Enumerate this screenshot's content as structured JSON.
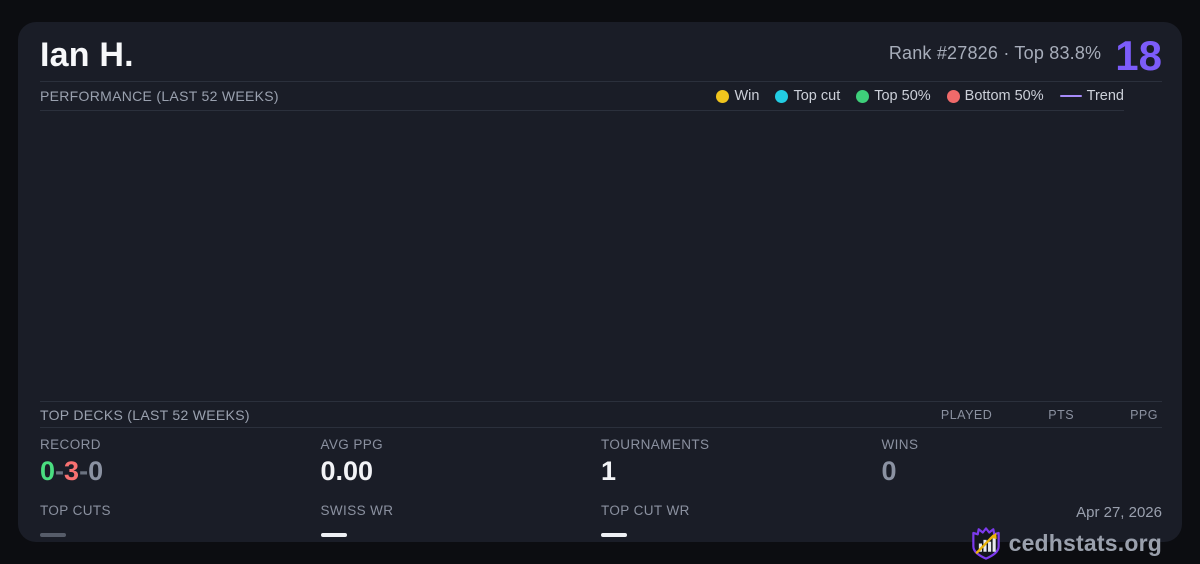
{
  "header": {
    "name": "Ian H.",
    "rank": "Rank #27826",
    "separator": "·",
    "top_percent": "Top 83.8%",
    "score": "18"
  },
  "performance": {
    "title": "PERFORMANCE (LAST 52 WEEKS)",
    "legend": {
      "win": "Win",
      "top_cut": "Top cut",
      "top_50": "Top 50%",
      "bottom_50": "Bottom 50%",
      "trend": "Trend"
    }
  },
  "chart_data": {
    "type": "scatter",
    "title": "PERFORMANCE (LAST 52 WEEKS)",
    "series": [
      {
        "name": "Win",
        "points": []
      },
      {
        "name": "Top cut",
        "points": []
      },
      {
        "name": "Top 50%",
        "points": []
      },
      {
        "name": "Bottom 50%",
        "points": []
      },
      {
        "name": "Trend",
        "points": []
      }
    ]
  },
  "top_decks": {
    "title": "TOP DECKS (LAST 52 WEEKS)",
    "columns": {
      "played": "PLAYED",
      "pts": "PTS",
      "ppg": "PPG"
    },
    "rows": []
  },
  "stats": {
    "record": {
      "label": "RECORD",
      "wins": "0",
      "losses": "3",
      "draws": "0",
      "sep": "-"
    },
    "avg_ppg": {
      "label": "AVG PPG",
      "value": "0.00"
    },
    "tournaments": {
      "label": "TOURNAMENTS",
      "value": "1"
    },
    "wins": {
      "label": "WINS",
      "value": "0"
    },
    "top_cuts": {
      "label": "TOP CUTS"
    },
    "swiss_wr": {
      "label": "SWISS WR"
    },
    "top_cut_wr": {
      "label": "TOP CUT WR"
    }
  },
  "footer": {
    "date": "Apr 27, 2026",
    "brand": "cedhstats.org"
  },
  "colors": {
    "background": "#0c0d11",
    "card": "#1a1d27",
    "divider": "#2b303c",
    "accent_purple": "#7c5cfa",
    "trend_purple": "#a78bfa",
    "win_yellow": "#f0c41d",
    "top_cut_cyan": "#22cce3",
    "top_50_green": "#3ecf7a",
    "bottom_50_red": "#f06a6a",
    "record_win_green": "#4ade80",
    "record_loss_red": "#f87171",
    "muted_gray": "#8b92a2"
  }
}
